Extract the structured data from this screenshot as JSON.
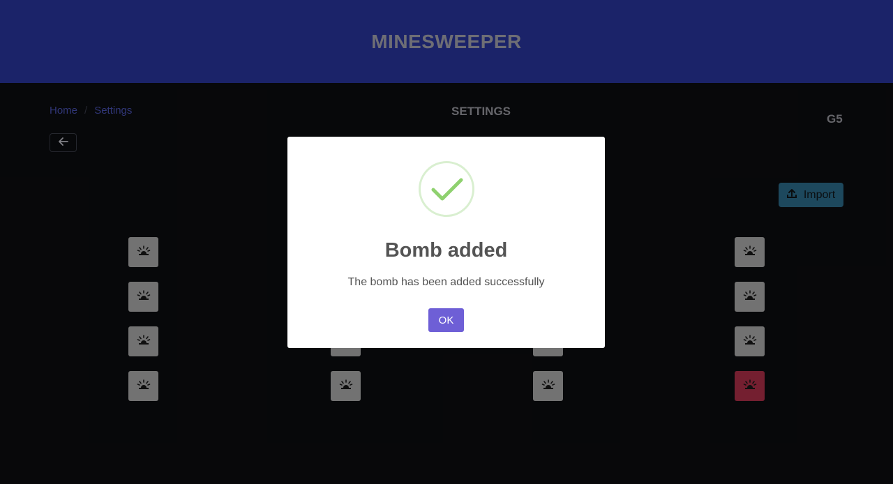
{
  "header": {
    "title": "MINESWEEPER"
  },
  "breadcrumb": {
    "home": "Home",
    "separator": "/",
    "current": "Settings"
  },
  "page": {
    "title": "SETTINGS",
    "level_code": "G5"
  },
  "toolbar": {
    "import_label": "Import"
  },
  "grid": {
    "rows": 4,
    "cols": 4,
    "bomb_cells": [
      [
        3,
        3
      ]
    ]
  },
  "colors": {
    "header_bg": "#2a37a2",
    "cell": "#b0b0b0",
    "bomb_cell": "#b3304a",
    "ok_button": "#6e5fd6",
    "import_button": "#2d6f8f"
  },
  "modal": {
    "title": "Bomb added",
    "message": "The bomb has been added successfully",
    "ok_label": "OK",
    "icon": "success-check-icon"
  }
}
